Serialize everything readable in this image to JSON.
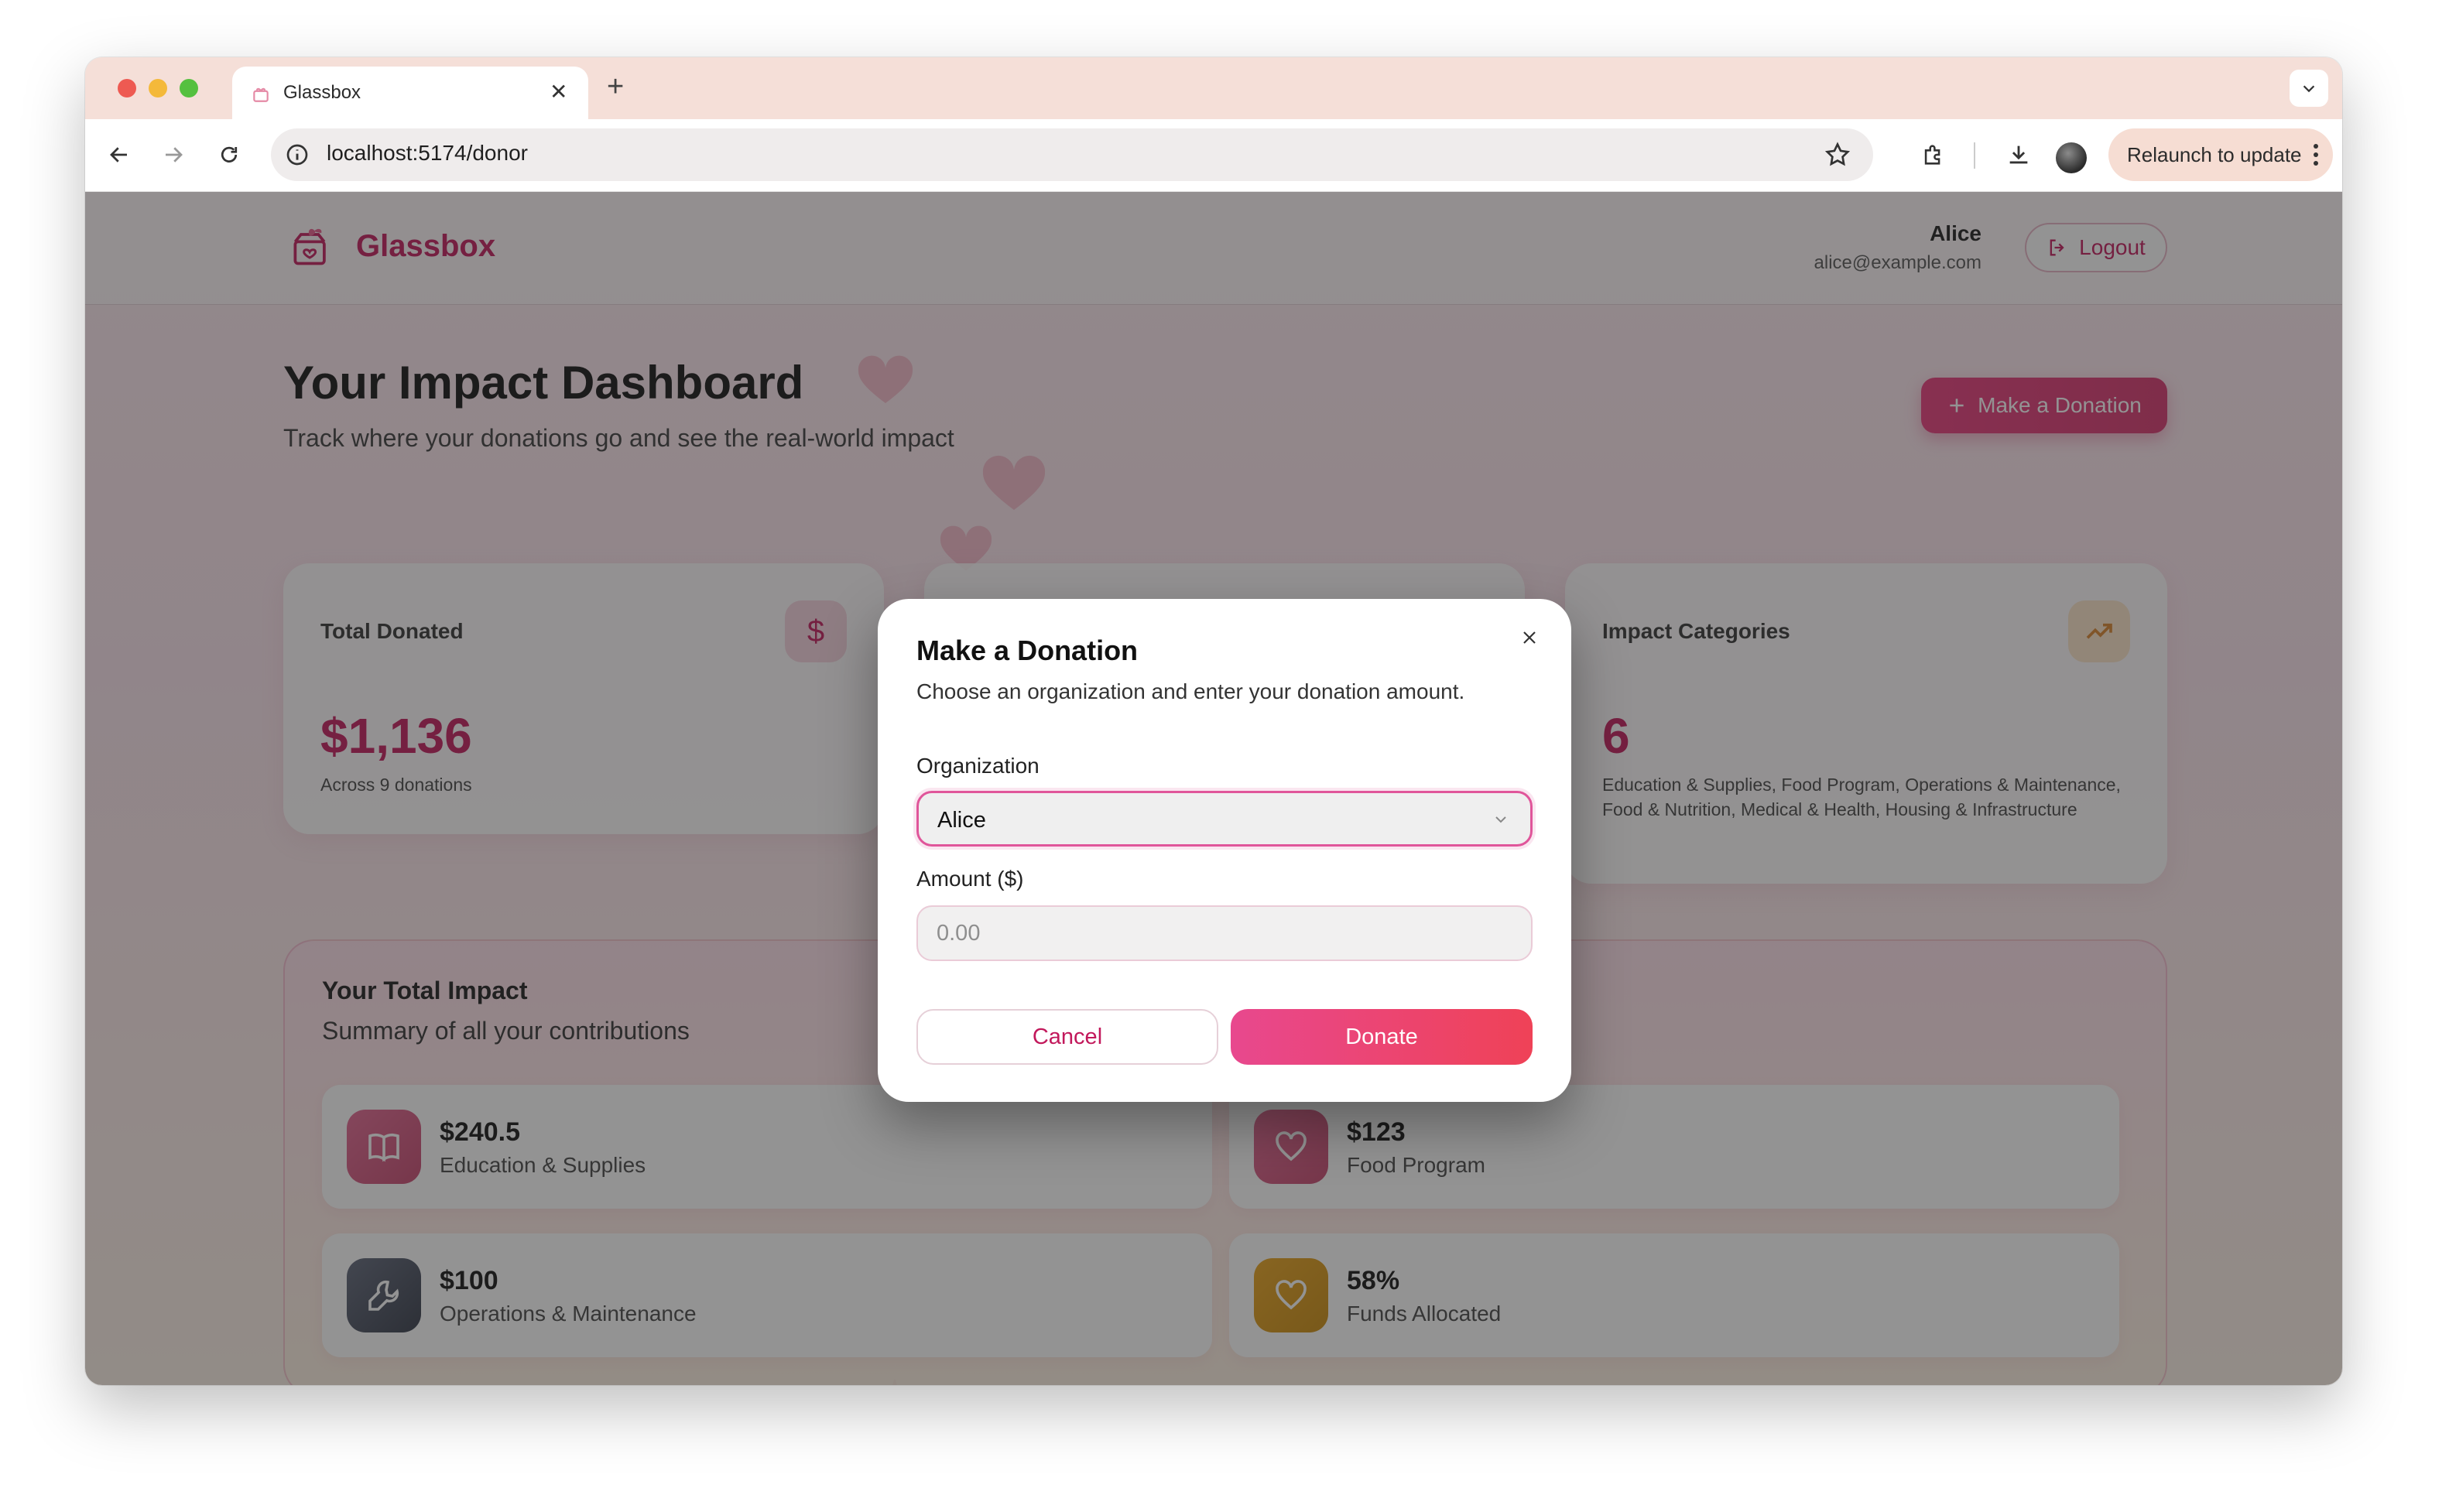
{
  "browser": {
    "tab_title": "Glassbox",
    "url": "localhost:5174/donor",
    "relaunch_label": "Relaunch to update"
  },
  "app": {
    "logo_text": "Glassbox",
    "user_name": "Alice",
    "user_email": "alice@example.com",
    "logout_label": "Logout"
  },
  "dashboard": {
    "title": "Your Impact Dashboard",
    "subtitle": "Track where your donations go and see the real-world impact",
    "make_donation_label": "Make a Donation",
    "cards": {
      "total_donated": {
        "label": "Total Donated",
        "value": "$1,136",
        "note": "Across 9 donations",
        "icon": "dollar-icon"
      },
      "impact_categories": {
        "label": "Impact Categories",
        "value": "6",
        "note": "Education & Supplies, Food Program, Operations & Maintenance, Food & Nutrition, Medical & Health, Housing & Infrastructure",
        "icon": "trending-up-icon"
      }
    },
    "impact": {
      "title": "Your Total Impact",
      "subtitle": "Summary of all your contributions",
      "items": [
        {
          "value": "$240.5",
          "label": "Education & Supplies",
          "icon": "book-icon",
          "color": "#c5456d"
        },
        {
          "value": "$123",
          "label": "Food Program",
          "icon": "heart-icon",
          "color": "#c5456d"
        },
        {
          "value": "$100",
          "label": "Operations & Maintenance",
          "icon": "wrench-icon",
          "color": "#3f4556"
        },
        {
          "value": "58%",
          "label": "Funds Allocated",
          "icon": "heart-icon",
          "color": "#c98a0c"
        }
      ]
    }
  },
  "modal": {
    "title": "Make a Donation",
    "description": "Choose an organization and enter your donation amount.",
    "organization_label": "Organization",
    "organization_value": "Alice",
    "amount_label": "Amount ($)",
    "amount_placeholder": "0.00",
    "cancel_label": "Cancel",
    "donate_label": "Donate"
  },
  "colors": {
    "accent": "#c2185b",
    "primary_button": "#e8387a",
    "donate_gradient_end": "#ef4257"
  }
}
